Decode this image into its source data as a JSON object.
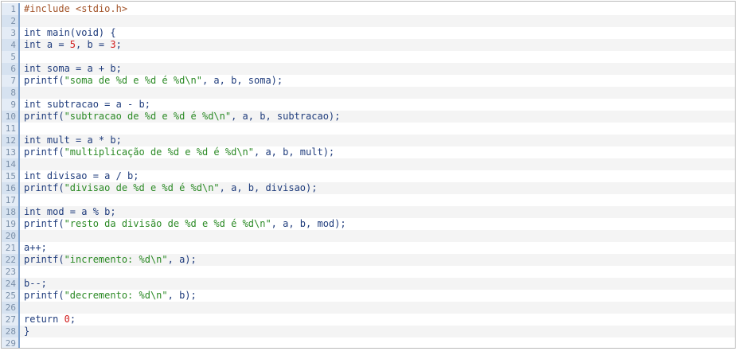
{
  "editor": {
    "lines": [
      {
        "n": "1",
        "t": [
          {
            "text": "#include <stdio.h>",
            "c": "pp"
          }
        ]
      },
      {
        "n": "2",
        "t": []
      },
      {
        "n": "3",
        "t": [
          {
            "text": "int main(void) {",
            "c": "ctl"
          }
        ]
      },
      {
        "n": "4",
        "t": [
          {
            "text": "int a = ",
            "c": "ctl"
          },
          {
            "text": "5",
            "c": "num"
          },
          {
            "text": ", b = ",
            "c": "ctl"
          },
          {
            "text": "3",
            "c": "num"
          },
          {
            "text": ";",
            "c": "ctl"
          }
        ]
      },
      {
        "n": "5",
        "t": []
      },
      {
        "n": "6",
        "t": [
          {
            "text": "int soma = a + b;",
            "c": "ctl"
          }
        ]
      },
      {
        "n": "7",
        "t": [
          {
            "text": "printf(",
            "c": "ctl"
          },
          {
            "text": "\"soma de %d e %d é %d\\n\"",
            "c": "str"
          },
          {
            "text": ", a, b, soma);",
            "c": "ctl"
          }
        ]
      },
      {
        "n": "8",
        "t": []
      },
      {
        "n": "9",
        "t": [
          {
            "text": "int subtracao = a - b;",
            "c": "ctl"
          }
        ]
      },
      {
        "n": "10",
        "t": [
          {
            "text": "printf(",
            "c": "ctl"
          },
          {
            "text": "\"subtracao de %d e %d é %d\\n\"",
            "c": "str"
          },
          {
            "text": ", a, b, subtracao);",
            "c": "ctl"
          }
        ]
      },
      {
        "n": "11",
        "t": []
      },
      {
        "n": "12",
        "t": [
          {
            "text": "int mult = a * b;",
            "c": "ctl"
          }
        ]
      },
      {
        "n": "13",
        "t": [
          {
            "text": "printf(",
            "c": "ctl"
          },
          {
            "text": "\"multiplicação de %d e %d é %d\\n\"",
            "c": "str"
          },
          {
            "text": ", a, b, mult);",
            "c": "ctl"
          }
        ]
      },
      {
        "n": "14",
        "t": []
      },
      {
        "n": "15",
        "t": [
          {
            "text": "int divisao = a / b;",
            "c": "ctl"
          }
        ]
      },
      {
        "n": "16",
        "t": [
          {
            "text": "printf(",
            "c": "ctl"
          },
          {
            "text": "\"divisao de %d e %d é %d\\n\"",
            "c": "str"
          },
          {
            "text": ", a, b, divisao);",
            "c": "ctl"
          }
        ]
      },
      {
        "n": "17",
        "t": []
      },
      {
        "n": "18",
        "t": [
          {
            "text": "int mod = a % b;",
            "c": "ctl"
          }
        ]
      },
      {
        "n": "19",
        "t": [
          {
            "text": "printf(",
            "c": "ctl"
          },
          {
            "text": "\"resto da divisão de %d e %d é %d\\n\"",
            "c": "str"
          },
          {
            "text": ", a, b, mod);",
            "c": "ctl"
          }
        ]
      },
      {
        "n": "20",
        "t": []
      },
      {
        "n": "21",
        "t": [
          {
            "text": "a++;",
            "c": "ctl"
          }
        ]
      },
      {
        "n": "22",
        "t": [
          {
            "text": "printf(",
            "c": "ctl"
          },
          {
            "text": "\"incremento: %d\\n\"",
            "c": "str"
          },
          {
            "text": ", a);",
            "c": "ctl"
          }
        ]
      },
      {
        "n": "23",
        "t": []
      },
      {
        "n": "24",
        "t": [
          {
            "text": "b--;",
            "c": "ctl"
          }
        ]
      },
      {
        "n": "25",
        "t": [
          {
            "text": "printf(",
            "c": "ctl"
          },
          {
            "text": "\"decremento: %d\\n\"",
            "c": "str"
          },
          {
            "text": ", b);",
            "c": "ctl"
          }
        ]
      },
      {
        "n": "26",
        "t": []
      },
      {
        "n": "27",
        "t": [
          {
            "text": "return ",
            "c": "ctl"
          },
          {
            "text": "0",
            "c": "num"
          },
          {
            "text": ";",
            "c": "ctl"
          }
        ]
      },
      {
        "n": "28",
        "t": [
          {
            "text": "}",
            "c": "ctl"
          }
        ]
      },
      {
        "n": "29",
        "t": []
      }
    ]
  },
  "colors": {
    "keyword": "#1f3c7c",
    "string": "#2b8a25",
    "number": "#d21d1d",
    "preprocessor": "#a3542a",
    "gutter_border": "#7ea2cf"
  }
}
